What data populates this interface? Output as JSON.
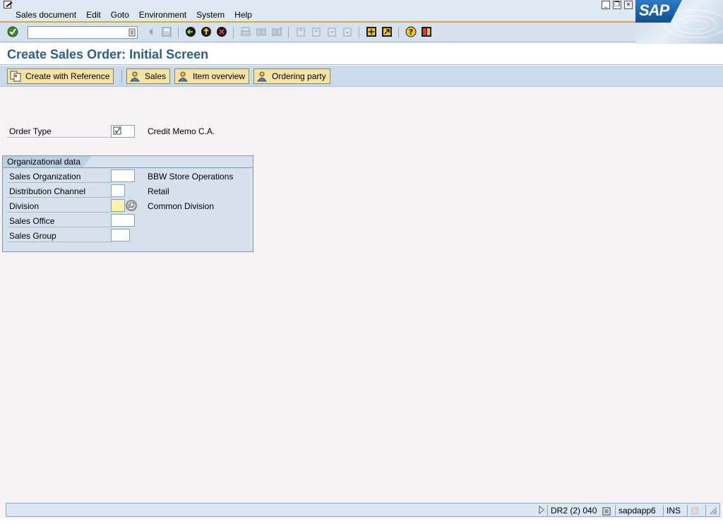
{
  "menu": {
    "items": [
      "Sales document",
      "Edit",
      "Goto",
      "Environment",
      "System",
      "Help"
    ]
  },
  "logo": "SAP",
  "toolbar": {
    "command_value": "",
    "icons": [
      "enter-icon",
      "back-icon",
      "save-icon",
      "back-green-icon",
      "exit-icon",
      "cancel-icon",
      "print-icon",
      "find-icon",
      "find-next-icon",
      "first-page-icon",
      "previous-page-icon",
      "next-page-icon",
      "last-page-icon",
      "create-session-icon",
      "shortcut-icon",
      "help-icon",
      "layout-menu-icon"
    ]
  },
  "title": "Create Sales Order: Initial Screen",
  "app_toolbar": {
    "buttons": [
      "Create with Reference",
      "Sales",
      "Item overview",
      "Ordering party"
    ]
  },
  "form": {
    "order_type": {
      "label": "Order Type",
      "value": "",
      "description": "Credit Memo C.A."
    },
    "group_title": "Organizational data",
    "fields": [
      {
        "label": "Sales Organization",
        "value": "",
        "description": "BBW Store Operations"
      },
      {
        "label": "Distribution Channel",
        "value": "",
        "description": "Retail"
      },
      {
        "label": "Division",
        "value": "",
        "description": "Common Division"
      },
      {
        "label": "Sales Office",
        "value": "",
        "description": ""
      },
      {
        "label": "Sales Group",
        "value": "",
        "description": ""
      }
    ]
  },
  "status": {
    "system": "DR2 (2) 040",
    "server": "sapdapp6",
    "mode": "INS"
  },
  "colors": {
    "title": "#2f5f87",
    "button_bg": "#f3e3a4",
    "required_field": "#fbf2a8",
    "menu_underline": "#e6a33a"
  }
}
